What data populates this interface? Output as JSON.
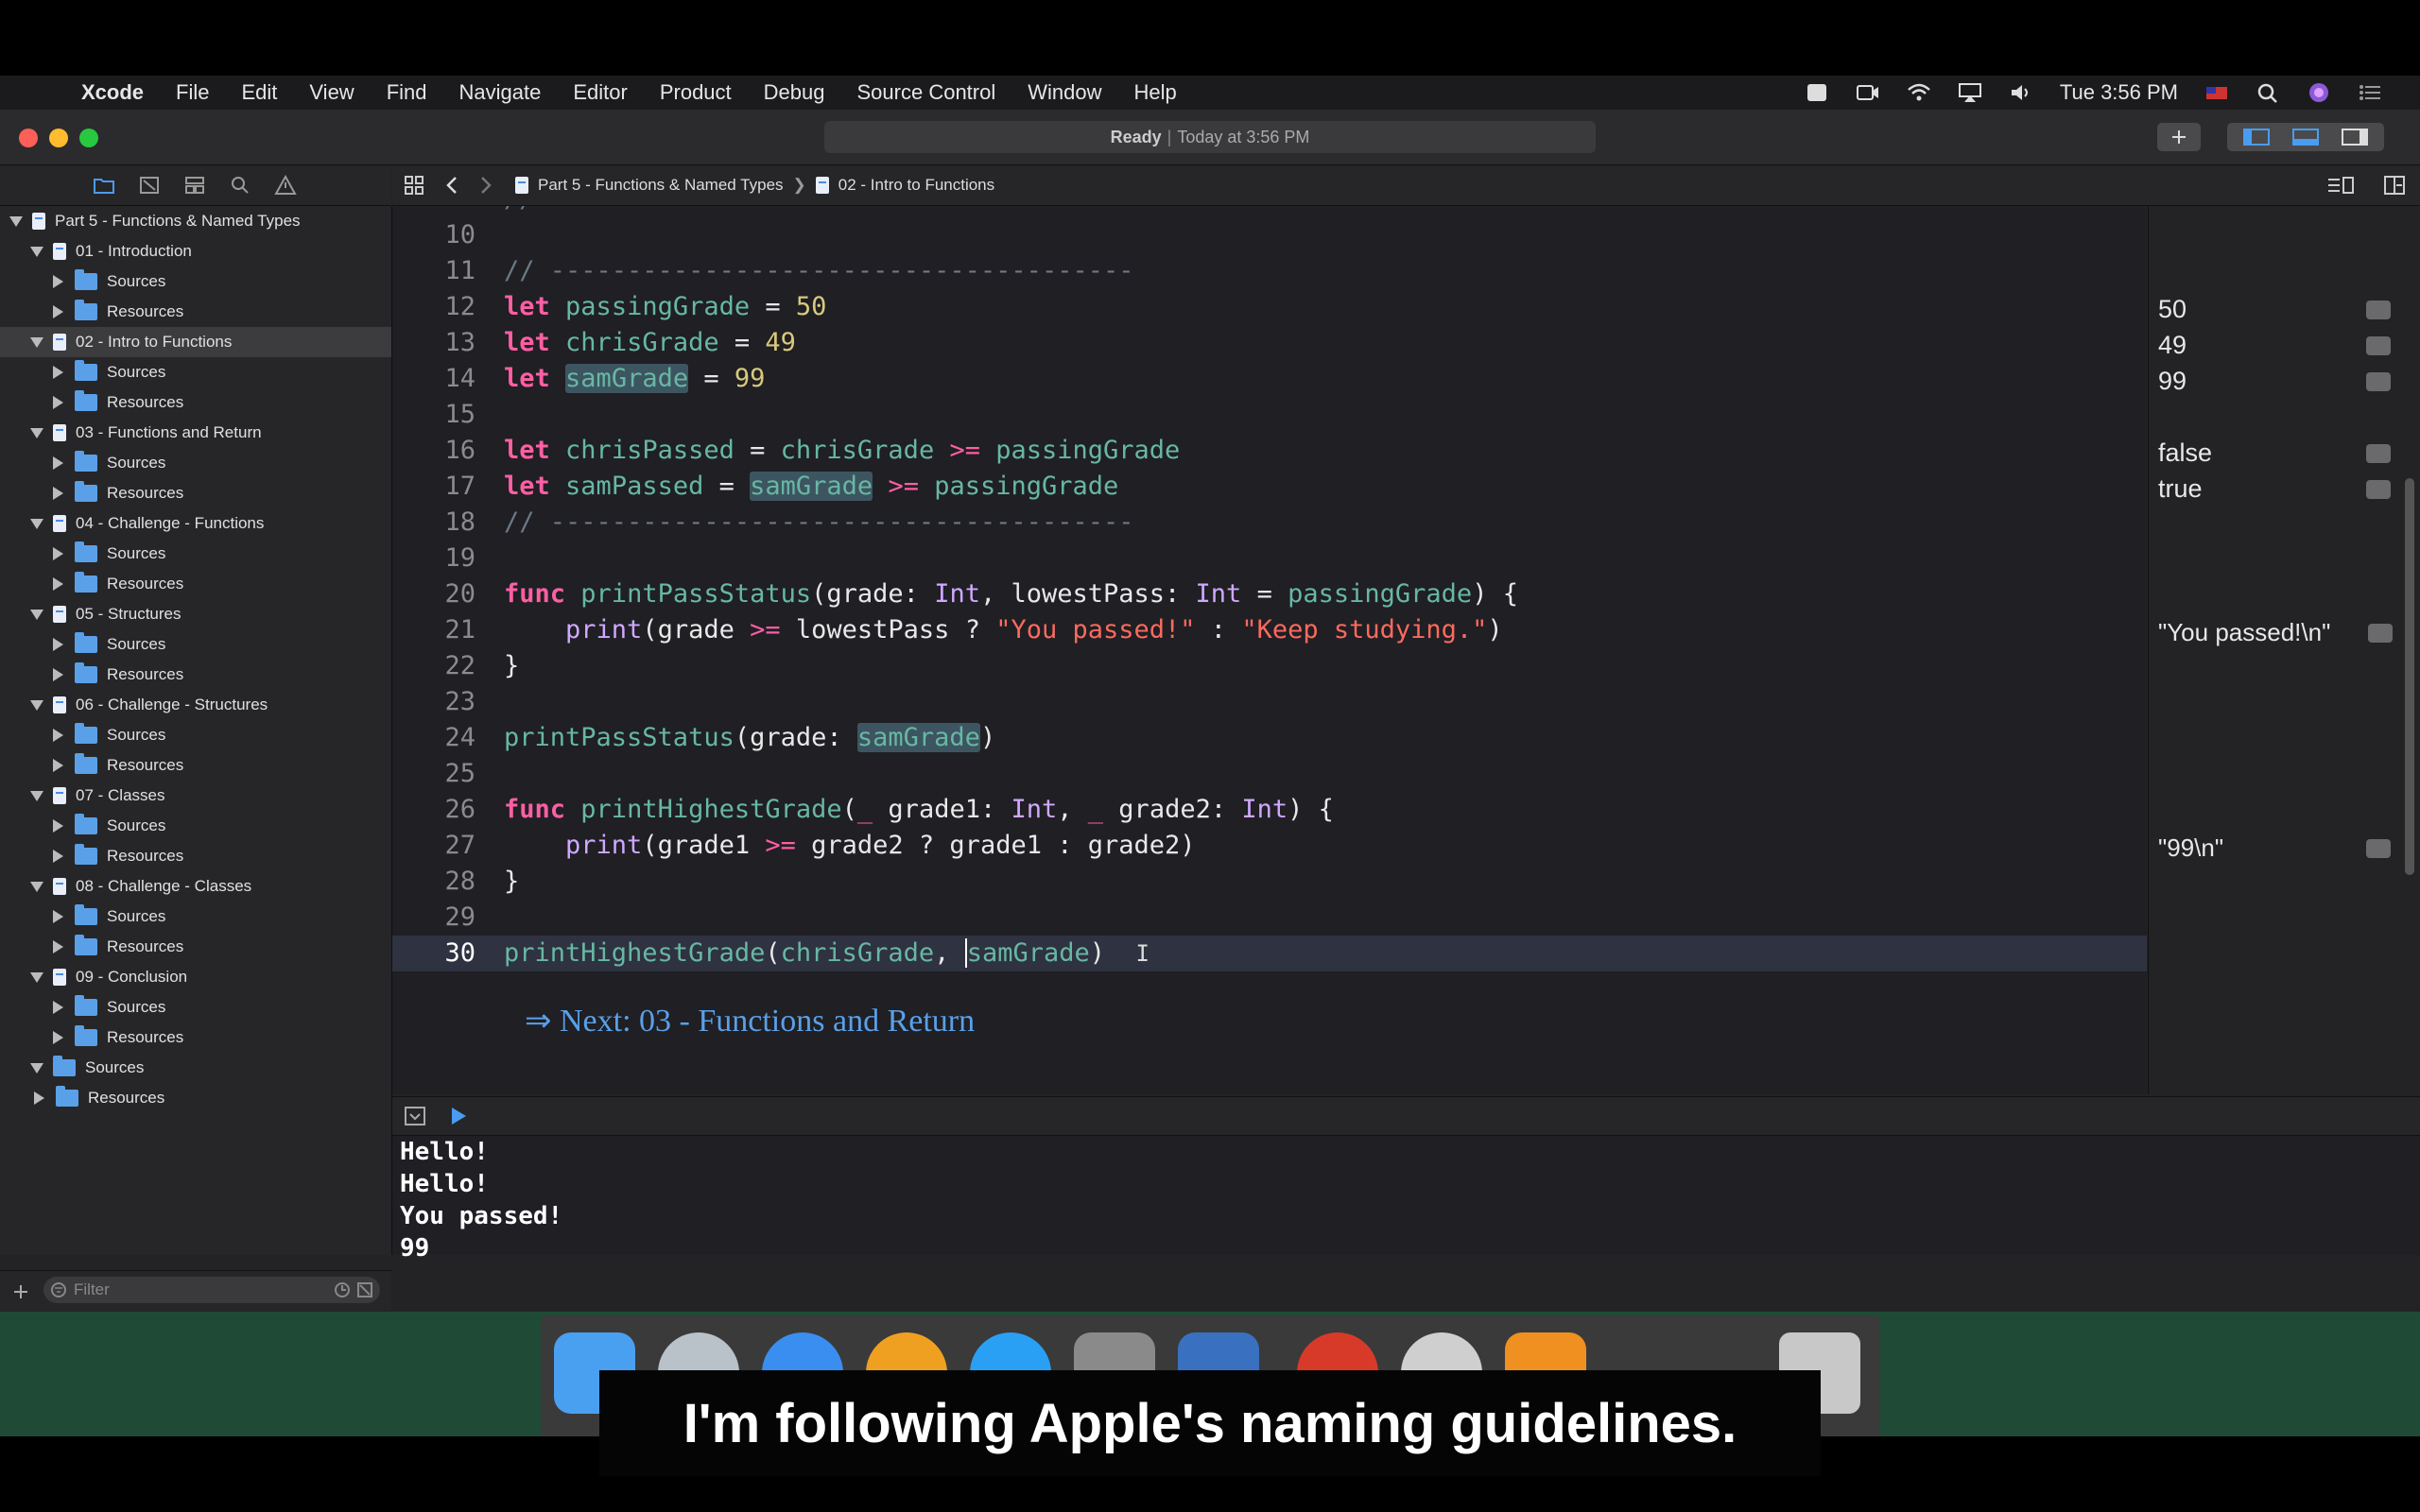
{
  "menubar": {
    "app": "Xcode",
    "items": [
      "File",
      "Edit",
      "View",
      "Find",
      "Navigate",
      "Editor",
      "Product",
      "Debug",
      "Source Control",
      "Window",
      "Help"
    ],
    "clock": "Tue 3:56 PM"
  },
  "titlebar": {
    "status_state": "Ready",
    "status_time": "Today at 3:56 PM"
  },
  "jumpbar": {
    "crumbs": [
      "Part 5 - Functions & Named Types",
      "02 - Intro to Functions"
    ]
  },
  "navigator": {
    "root": "Part 5 - Functions & Named Types",
    "pages": [
      {
        "name": "01 - Introduction"
      },
      {
        "name": "02 - Intro to Functions"
      },
      {
        "name": "03 - Functions and Return"
      },
      {
        "name": "04 - Challenge - Functions"
      },
      {
        "name": "05 - Structures"
      },
      {
        "name": "06 - Challenge - Structures"
      },
      {
        "name": "07 - Classes"
      },
      {
        "name": "08 - Challenge - Classes"
      },
      {
        "name": "09 - Conclusion"
      }
    ],
    "sources": "Sources",
    "resources": "Resources",
    "filter_placeholder": "Filter"
  },
  "editor": {
    "line_numbers": [
      "10",
      "11",
      "12",
      "13",
      "14",
      "15",
      "16",
      "17",
      "18",
      "19",
      "20",
      "21",
      "22",
      "23",
      "24",
      "25",
      "26",
      "27",
      "28",
      "29",
      "30"
    ],
    "current_line": "30",
    "next_link": "⇒ Next: 03 - Functions and Return"
  },
  "results": {
    "values": [
      "50",
      "49",
      "99",
      "false",
      "true",
      "\"You passed!\\n\"",
      "\"99\\n\""
    ]
  },
  "console": {
    "lines": [
      "Hello!",
      "Hello!",
      "You passed!",
      "99"
    ]
  },
  "caption": "I'm following Apple's naming guidelines."
}
